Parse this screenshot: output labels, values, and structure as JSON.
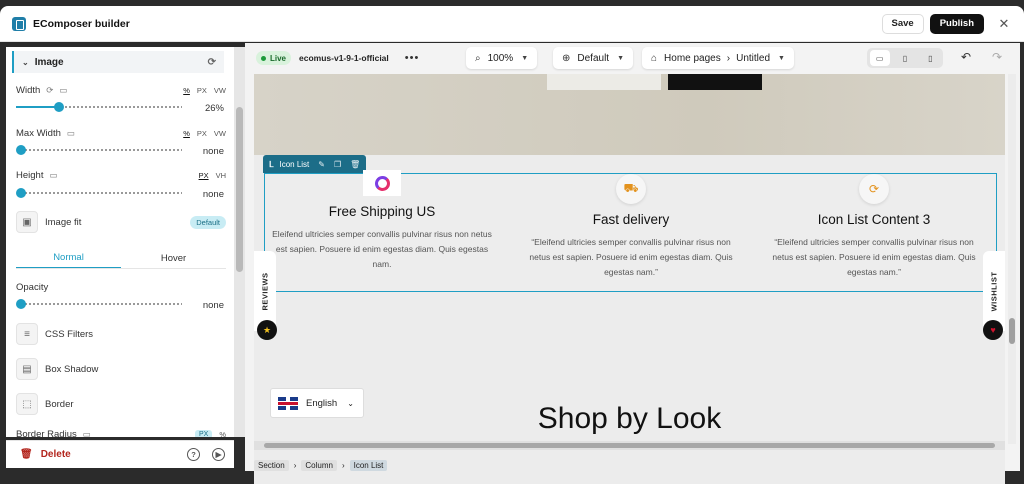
{
  "app": {
    "title": "EComposer builder",
    "save_label": "Save",
    "publish_label": "Publish",
    "close": "✕"
  },
  "panel": {
    "section_title": "Image",
    "width": {
      "label": "Width",
      "units": [
        "%",
        "PX",
        "VW"
      ],
      "active_unit": "%",
      "value": "26%",
      "level": 0.26
    },
    "max_width": {
      "label": "Max Width",
      "units": [
        "%",
        "PX",
        "VW"
      ],
      "active_unit": "%",
      "value": "none",
      "level": 0
    },
    "height": {
      "label": "Height",
      "units": [
        "PX",
        "VH"
      ],
      "active_unit": "PX",
      "value": "none",
      "level": 0
    },
    "image_fit": {
      "label": "Image fit",
      "badge": "Default"
    },
    "tabs": [
      "Normal",
      "Hover"
    ],
    "opacity": {
      "label": "Opacity",
      "value": "none",
      "level": 0
    },
    "css_filters": "CSS Filters",
    "box_shadow": "Box Shadow",
    "border": "Border",
    "border_radius": {
      "label": "Border Radius",
      "units": [
        "PX",
        "%"
      ]
    },
    "delete_label": "Delete"
  },
  "topbar": {
    "live": "Live",
    "site": "ecomus-v1-9-1-official",
    "zoom": "100%",
    "locale": "Default",
    "page_path": [
      "Home pages",
      "Untitled"
    ]
  },
  "canvas": {
    "icon_list_tag": "Icon List",
    "items": [
      {
        "title": "Free Shipping US",
        "text": "Eleifend ultricies semper convallis pulvinar risus non netus est sapien. Posuere id enim egestas diam. Quis egestas nam.",
        "icon": "e-logo-icon"
      },
      {
        "title": "Fast delivery",
        "text": "“Eleifend ultricies semper convallis pulvinar risus non netus est sapien. Posuere id enim egestas diam. Quis egestas nam.”",
        "icon": "truck-icon"
      },
      {
        "title": "Icon List Content 3",
        "text": "“Eleifend ultricies semper convallis pulvinar risus non netus est sapien. Posuere id enim egestas diam. Quis egestas nam.”",
        "icon": "refresh-icon"
      }
    ],
    "reviews_tab": "REVIEWS",
    "wishlist_tab": "WISHLIST",
    "language": "English",
    "heading": "Shop by Look"
  },
  "breadcrumbs": [
    "Section",
    "Column",
    "Icon List"
  ],
  "colors": {
    "accent": "#1f9ec4",
    "publish_bg": "#111111",
    "delete": "#b3261e",
    "live_bg": "#d9f2dc"
  }
}
